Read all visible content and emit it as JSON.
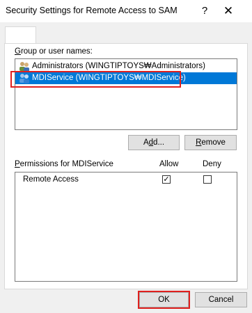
{
  "window": {
    "title": "Security Settings for Remote Access to SAM",
    "help_glyph": "?",
    "close_glyph": "✕"
  },
  "tab": {
    "label": ""
  },
  "groups": {
    "label_prefix": "",
    "label_mnemonic": "G",
    "label_rest": "roup or user names:",
    "items": [
      {
        "name": "Administrators (WINGTIPTOYS₩Administrators)",
        "icon": "users-icon",
        "selected": false
      },
      {
        "name": "MDIService (WINGTIPTOYS₩MDIService)",
        "icon": "users-icon",
        "selected": true
      }
    ],
    "add_pre": "A",
    "add_mnemonic": "d",
    "add_post": "d...",
    "remove_mnemonic": "R",
    "remove_post": "emove"
  },
  "permissions": {
    "label_mnemonic": "P",
    "label_rest": "ermissions for MDIService",
    "allow_header": "Allow",
    "deny_header": "Deny",
    "rows": [
      {
        "name": "Remote Access",
        "allow": "✓",
        "deny": ""
      }
    ]
  },
  "footer": {
    "ok_label": "OK",
    "cancel_label": "Cancel"
  },
  "colors": {
    "selection": "#0078d7",
    "highlight": "#e0201e"
  }
}
